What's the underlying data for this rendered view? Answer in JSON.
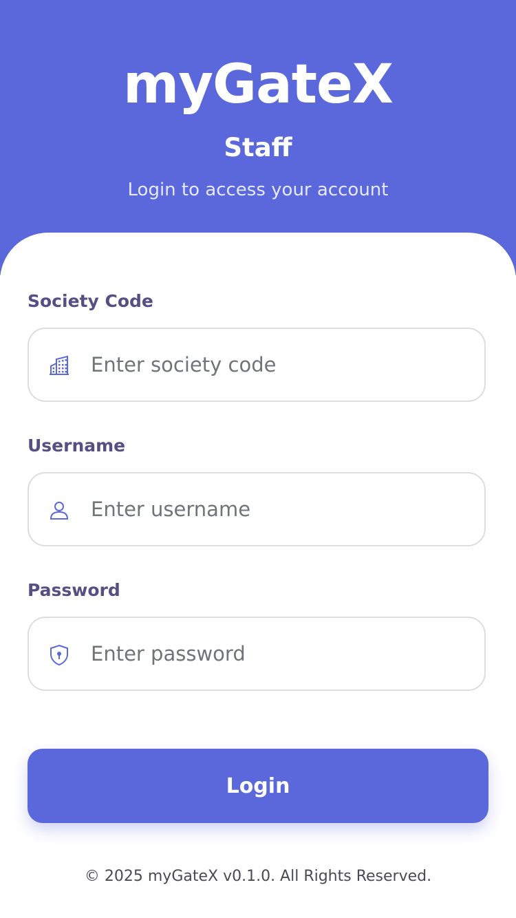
{
  "header": {
    "logo": "myGateX",
    "role": "Staff",
    "subtitle": "Login to access your account"
  },
  "form": {
    "society_code": {
      "label": "Society Code",
      "placeholder": "Enter society code",
      "value": "",
      "icon": "building-icon"
    },
    "username": {
      "label": "Username",
      "placeholder": "Enter username",
      "value": "",
      "icon": "user-icon"
    },
    "password": {
      "label": "Password",
      "placeholder": "Enter password",
      "value": "",
      "icon": "shield-lock-icon"
    },
    "login_label": "Login"
  },
  "footer": {
    "text": "© 2025 myGateX v0.1.0. All Rights Reserved."
  },
  "colors": {
    "primary": "#5b68db",
    "label": "#574f83",
    "border": "#dcdde2",
    "placeholder": "#6e7478"
  }
}
